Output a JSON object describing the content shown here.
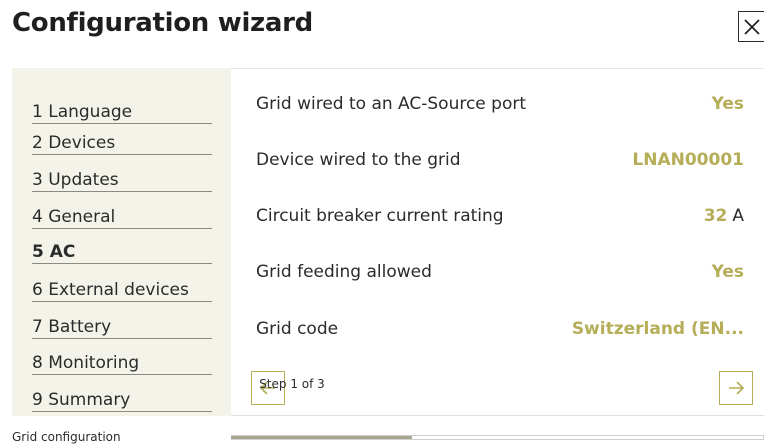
{
  "header": {
    "title": "Configuration wizard",
    "close_icon": "close-icon"
  },
  "sidebar": {
    "items": [
      {
        "label": "1 Language",
        "active": false
      },
      {
        "label": "2 Devices",
        "active": false
      },
      {
        "label": "3 Updates",
        "active": false
      },
      {
        "label": "4 General",
        "active": false
      },
      {
        "label": "5 AC",
        "active": true
      },
      {
        "label": "6 External devices",
        "active": false
      },
      {
        "label": "7 Battery",
        "active": false
      },
      {
        "label": "8 Monitoring",
        "active": false
      },
      {
        "label": "9 Summary",
        "active": false
      }
    ]
  },
  "main": {
    "rows": [
      {
        "label": "Grid wired to an AC-Source port",
        "value": "Yes",
        "unit": ""
      },
      {
        "label": "Device wired to the grid",
        "value": "LNAN00001",
        "unit": ""
      },
      {
        "label": "Circuit breaker current rating",
        "value": "32",
        "unit": "A"
      },
      {
        "label": "Grid feeding allowed",
        "value": "Yes",
        "unit": ""
      },
      {
        "label": "Grid code",
        "value": "Switzerland (EN...",
        "unit": ""
      }
    ],
    "pager": {
      "step_text": "Step 1 of 3",
      "prev_icon": "arrow-left-icon",
      "next_icon": "arrow-right-icon"
    }
  },
  "footer": {
    "label": "Grid configuration",
    "progress": 0.34
  },
  "colors": {
    "accent": "#b5ad57",
    "sidebar_bg": "#f4f3ea",
    "progress_fill": "#a8a690"
  }
}
